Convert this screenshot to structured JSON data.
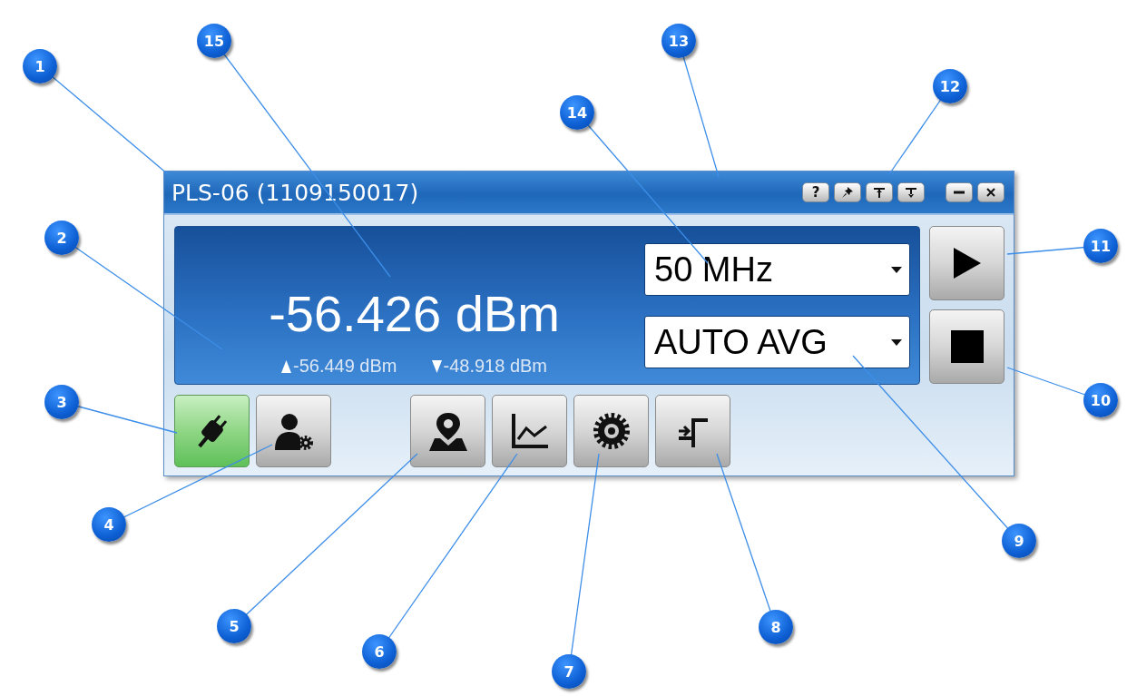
{
  "window": {
    "title": "PLS-06 (1109150017)"
  },
  "title_buttons": [
    {
      "kind": "help",
      "label": "?"
    },
    {
      "kind": "pin"
    },
    {
      "kind": "raise"
    },
    {
      "kind": "lower"
    },
    {
      "kind": "minimize"
    },
    {
      "kind": "close"
    }
  ],
  "reading": {
    "value": "-56.426 dBm",
    "up_value": "-56.449 dBm",
    "down_value": "-48.918 dBm"
  },
  "frequency": {
    "value": "50 MHz"
  },
  "averaging": {
    "value": "AUTO AVG"
  },
  "controls": [
    {
      "kind": "play"
    },
    {
      "kind": "stop"
    }
  ],
  "toolbar": [
    {
      "kind": "connect",
      "on": true
    },
    {
      "kind": "user-settings",
      "on": false
    },
    {
      "kind": "location",
      "on": false
    },
    {
      "kind": "chart",
      "on": false
    },
    {
      "kind": "settings",
      "on": false
    },
    {
      "kind": "step",
      "on": false
    }
  ],
  "callouts": [
    {
      "number": "1"
    },
    {
      "number": "2"
    },
    {
      "number": "3"
    },
    {
      "number": "4"
    },
    {
      "number": "5"
    },
    {
      "number": "6"
    },
    {
      "number": "7"
    },
    {
      "number": "8"
    },
    {
      "number": "9"
    },
    {
      "number": "10"
    },
    {
      "number": "11"
    },
    {
      "number": "12"
    },
    {
      "number": "13"
    },
    {
      "number": "14"
    },
    {
      "number": "15"
    }
  ]
}
